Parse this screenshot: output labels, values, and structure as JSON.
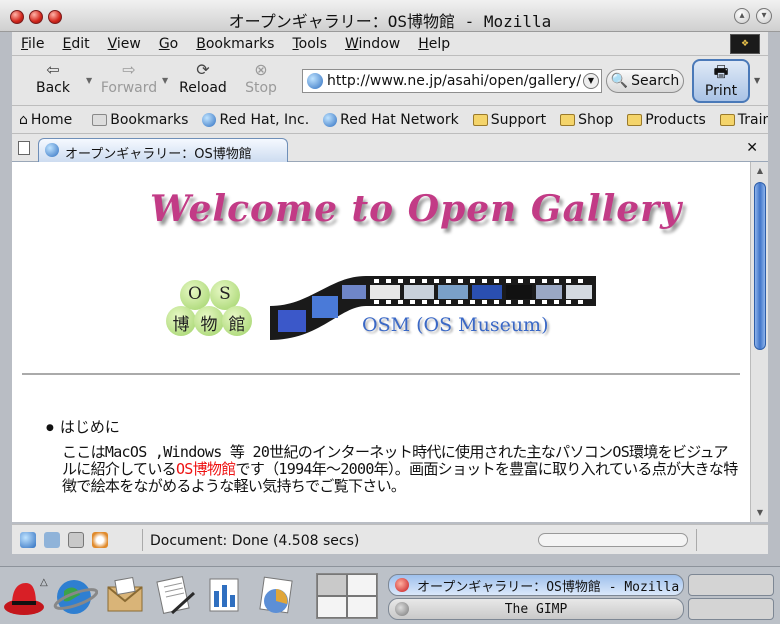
{
  "window": {
    "title": "オープンギャラリー：OS博物館 - Mozilla"
  },
  "menubar": {
    "items": [
      "File",
      "Edit",
      "View",
      "Go",
      "Bookmarks",
      "Tools",
      "Window",
      "Help"
    ]
  },
  "navbar": {
    "back": "Back",
    "forward": "Forward",
    "reload": "Reload",
    "stop": "Stop",
    "url": "http://www.ne.jp/asahi/open/gallery/",
    "search": "Search",
    "print": "Print"
  },
  "bookmarks": {
    "home": "Home",
    "bookmarks": "Bookmarks",
    "items": [
      "Red Hat, Inc.",
      "Red Hat Network",
      "Support",
      "Shop",
      "Products",
      "Training"
    ]
  },
  "tabs": [
    {
      "label": "オープンギャラリー：OS博物館"
    }
  ],
  "page": {
    "welcome": "Welcome to Open Gallery",
    "badge_os": [
      "O",
      "S"
    ],
    "badge_jp": [
      "博",
      "物",
      "館"
    ],
    "osm": "OSM (OS Museum)",
    "heading": "はじめに",
    "para_pre": "ここはMacOS ,Windows 等 20世紀のインターネット時代に使用された主なパソコンOS環境をビジュアルに紹介している",
    "para_link": "OS博物館",
    "para_post": "です（1994年～2000年）。画面ショットを豊富に取り入れている点が大きな特徴で絵本をながめるような軽い気持ちでご覧下さい。"
  },
  "status": {
    "text": "Document: Done (4.508 secs)"
  },
  "taskbar": {
    "tasks": [
      "オープンギャラリー：OS博物館 - Mozilla",
      "The GIMP"
    ]
  },
  "colors": {
    "welcome": "#c23b86",
    "osm": "#3a68c6",
    "link": "#e11111",
    "accent": "#3f74c8"
  }
}
